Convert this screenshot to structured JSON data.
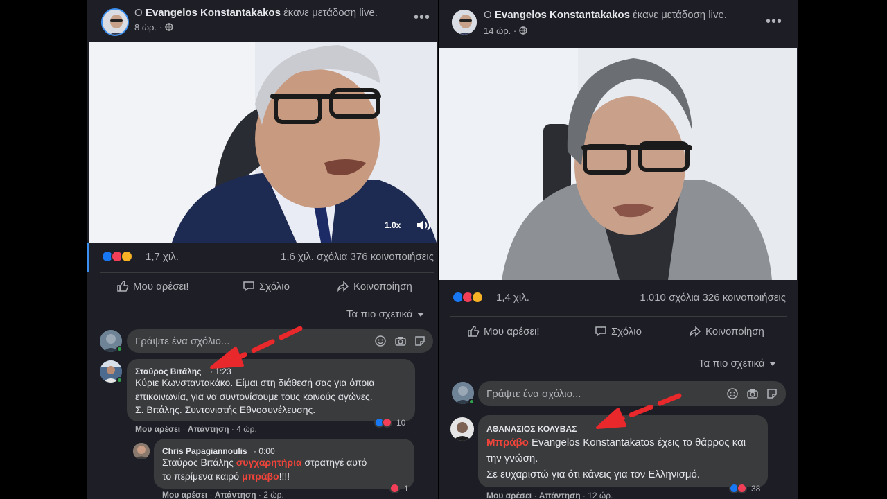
{
  "left_post": {
    "author_prefix": "Ο",
    "author": "Evangelos Konstantakakos",
    "action": "έκανε μετάδοση live.",
    "time": "8 ώρ. ·",
    "video": {
      "speed": "1.0x"
    },
    "reactions_count": "1,7 χιλ.",
    "stats": "1,6 χιλ. σχόλια  376 κοινοποιήσεις",
    "actions": {
      "like": "Μου αρέσει!",
      "comment": "Σχόλιο",
      "share": "Κοινοποίηση"
    },
    "sort": "Τα πιο σχετικά",
    "compose_placeholder": "Γράψτε ένα σχόλιο...",
    "comments": [
      {
        "author": "Σταύρος Βιτάλης",
        "time": "· 1:23",
        "lines": [
          "Κύριε Κωνσταντακάκο. Είμαι στη διάθεσή σας για όποια",
          "επικοινωνία, για να συντονίσουμε τους κοινούς αγώνες.",
          "Σ. Βιτάλης. Συντονιστής Εθνοσυνέλευσης."
        ],
        "like": "Μου αρέσει",
        "reply": "Απάντηση",
        "age": "4 ώρ.",
        "reaction_count": "10"
      },
      {
        "author": "Chris Papagiannoulis",
        "time": "· 0:00",
        "line1_a": "Σταύρος Βιτάλης ",
        "line1_hl": "συγχαρητήρια",
        "line1_b": " στρατηγέ αυτό",
        "line2_a": "το περίμενα καιρό ",
        "line2_hl": "μπράβο",
        "line2_b": "!!!!",
        "like": "Μου αρέσει",
        "reply": "Απάντηση",
        "age": "2 ώρ.",
        "reaction_count": "1"
      }
    ]
  },
  "right_post": {
    "author_prefix": "Ο",
    "author": "Evangelos Konstantakakos",
    "action": "έκανε μετάδοση live.",
    "time": "14 ώρ. ·",
    "reactions_count": "1,4 χιλ.",
    "stats": "1.010 σχόλια  326 κοινοποιήσεις",
    "actions": {
      "like": "Μου αρέσει!",
      "comment": "Σχόλιο",
      "share": "Κοινοποίηση"
    },
    "sort": "Τα πιο σχετικά",
    "compose_placeholder": "Γράψτε ένα σχόλιο...",
    "comment": {
      "author": "ΑΘΑΝΑΣΙΟΣ ΚΟΛΥΒΑΣ",
      "line1_hl": "Μπράβο",
      "line1_b": " Evangelos Konstantakatos έχεις το θάρρος και",
      "line2": "την γνώση.",
      "line3": "Σε ευχαριστώ για ότι κάνεις για τον Ελληνισμό.",
      "like": "Μου αρέσει",
      "reply": "Απάντηση",
      "age": "12 ώρ.",
      "reaction_count": "38"
    }
  },
  "colors": {
    "annotation_arrow": "#e8282b",
    "highlight": "#f0443a",
    "link_blue": "#1877f2"
  }
}
